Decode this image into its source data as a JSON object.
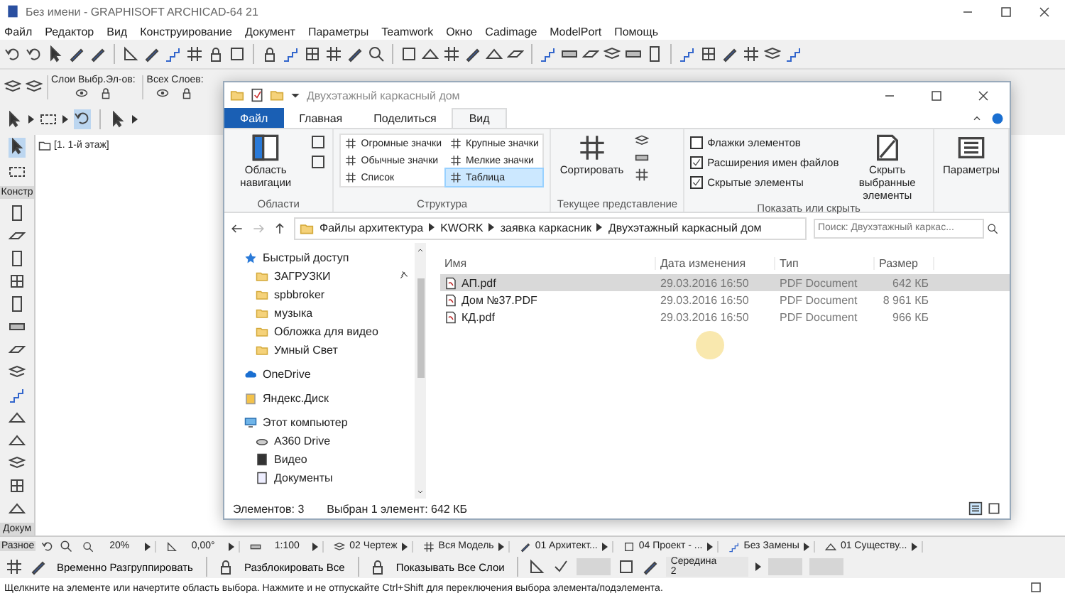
{
  "app": {
    "title": "Без имени - GRAPHISOFT ARCHICAD-64 21",
    "menu": [
      "Файл",
      "Редактор",
      "Вид",
      "Конструирование",
      "Документ",
      "Параметры",
      "Teamwork",
      "Окно",
      "Cadimage",
      "ModelPort",
      "Помощь"
    ],
    "layer_groups": [
      "Слои Выбр.Эл-ов:",
      "Всех Слоев:"
    ],
    "palette_groups": [
      "Констр",
      "Докум"
    ],
    "view_tab": "[1. 1-й этаж]",
    "quick_label": "Разное",
    "quick_options": [
      "20%",
      "0,00°",
      "1:100",
      "02 Чертеж",
      "Вся Модель",
      "01 Архитект...",
      "04 Проект - ...",
      "Без Замены",
      "01 Существу..."
    ],
    "info_buttons": [
      "Временно Разгруппировать",
      "Разблокировать Все",
      "Показывать Все Слои"
    ],
    "snap": {
      "label": "Середина",
      "value": "2"
    },
    "status": "Щелкните на элементе или начертите область выбора. Нажмите и не отпускайте Ctrl+Shift для переключения выбора элемента/подэлемента."
  },
  "explorer": {
    "title": "Двухэтажный каркасный дом",
    "tabs": [
      {
        "label": "Файл",
        "selected": false,
        "kind": "file"
      },
      {
        "label": "Главная",
        "selected": false,
        "kind": "tab"
      },
      {
        "label": "Поделиться",
        "selected": false,
        "kind": "tab"
      },
      {
        "label": "Вид",
        "selected": true,
        "kind": "tab"
      }
    ],
    "areas": {
      "button": "Область навигации",
      "label": "Области"
    },
    "layouts": {
      "items": [
        {
          "label": "Огромные значки",
          "selected": false
        },
        {
          "label": "Крупные значки",
          "selected": false
        },
        {
          "label": "Обычные значки",
          "selected": false
        },
        {
          "label": "Мелкие значки",
          "selected": false
        },
        {
          "label": "Список",
          "selected": false
        },
        {
          "label": "Таблица",
          "selected": true
        }
      ],
      "label": "Структура"
    },
    "current_view": {
      "button": "Сортировать",
      "label": "Текущее представление"
    },
    "show_hide": {
      "checks": [
        {
          "label": "Флажки элементов",
          "checked": false
        },
        {
          "label": "Расширения имен файлов",
          "checked": true
        },
        {
          "label": "Скрытые элементы",
          "checked": true
        }
      ],
      "hide_button": "Скрыть выбранные элементы",
      "options_button": "Параметры",
      "label": "Показать или скрыть"
    },
    "path": [
      "Файлы архитектура",
      "KWORK",
      "заявка каркасник",
      "Двухэтажный каркасный дом"
    ],
    "search": {
      "placeholder": "Поиск: Двухэтажный каркас..."
    },
    "nav": [
      {
        "label": "Быстрый доступ",
        "kind": "star",
        "children": [
          {
            "label": "ЗАГРУЗКИ",
            "kind": "folder",
            "pinned": true
          },
          {
            "label": "spbbroker",
            "kind": "folder",
            "pinned": false
          },
          {
            "label": "музыка",
            "kind": "folder",
            "pinned": false
          },
          {
            "label": "Обложка для видео",
            "kind": "folder",
            "pinned": false
          },
          {
            "label": "Умный Свет",
            "kind": "folder",
            "pinned": false
          }
        ]
      },
      {
        "label": "OneDrive",
        "kind": "cloud"
      },
      {
        "label": "Яндекс.Диск",
        "kind": "disk"
      },
      {
        "label": "Этот компьютер",
        "kind": "pc",
        "children": [
          {
            "label": "A360 Drive",
            "kind": "drive"
          },
          {
            "label": "Видео",
            "kind": "video"
          },
          {
            "label": "Документы",
            "kind": "docs"
          }
        ]
      }
    ],
    "columns": [
      "Имя",
      "Дата изменения",
      "Тип",
      "Размер"
    ],
    "rows": [
      {
        "cells": [
          "АП.pdf",
          "29.03.2016 16:50",
          "PDF Document",
          "642 КБ"
        ],
        "selected": true
      },
      {
        "cells": [
          "Дом №37.PDF",
          "29.03.2016 16:50",
          "PDF Document",
          "8 961 КБ"
        ],
        "selected": false
      },
      {
        "cells": [
          "КД.pdf",
          "29.03.2016 16:50",
          "PDF Document",
          "966 КБ"
        ],
        "selected": false
      }
    ],
    "status": [
      "Элементов: 3",
      "Выбран 1 элемент: 642 КБ"
    ]
  }
}
